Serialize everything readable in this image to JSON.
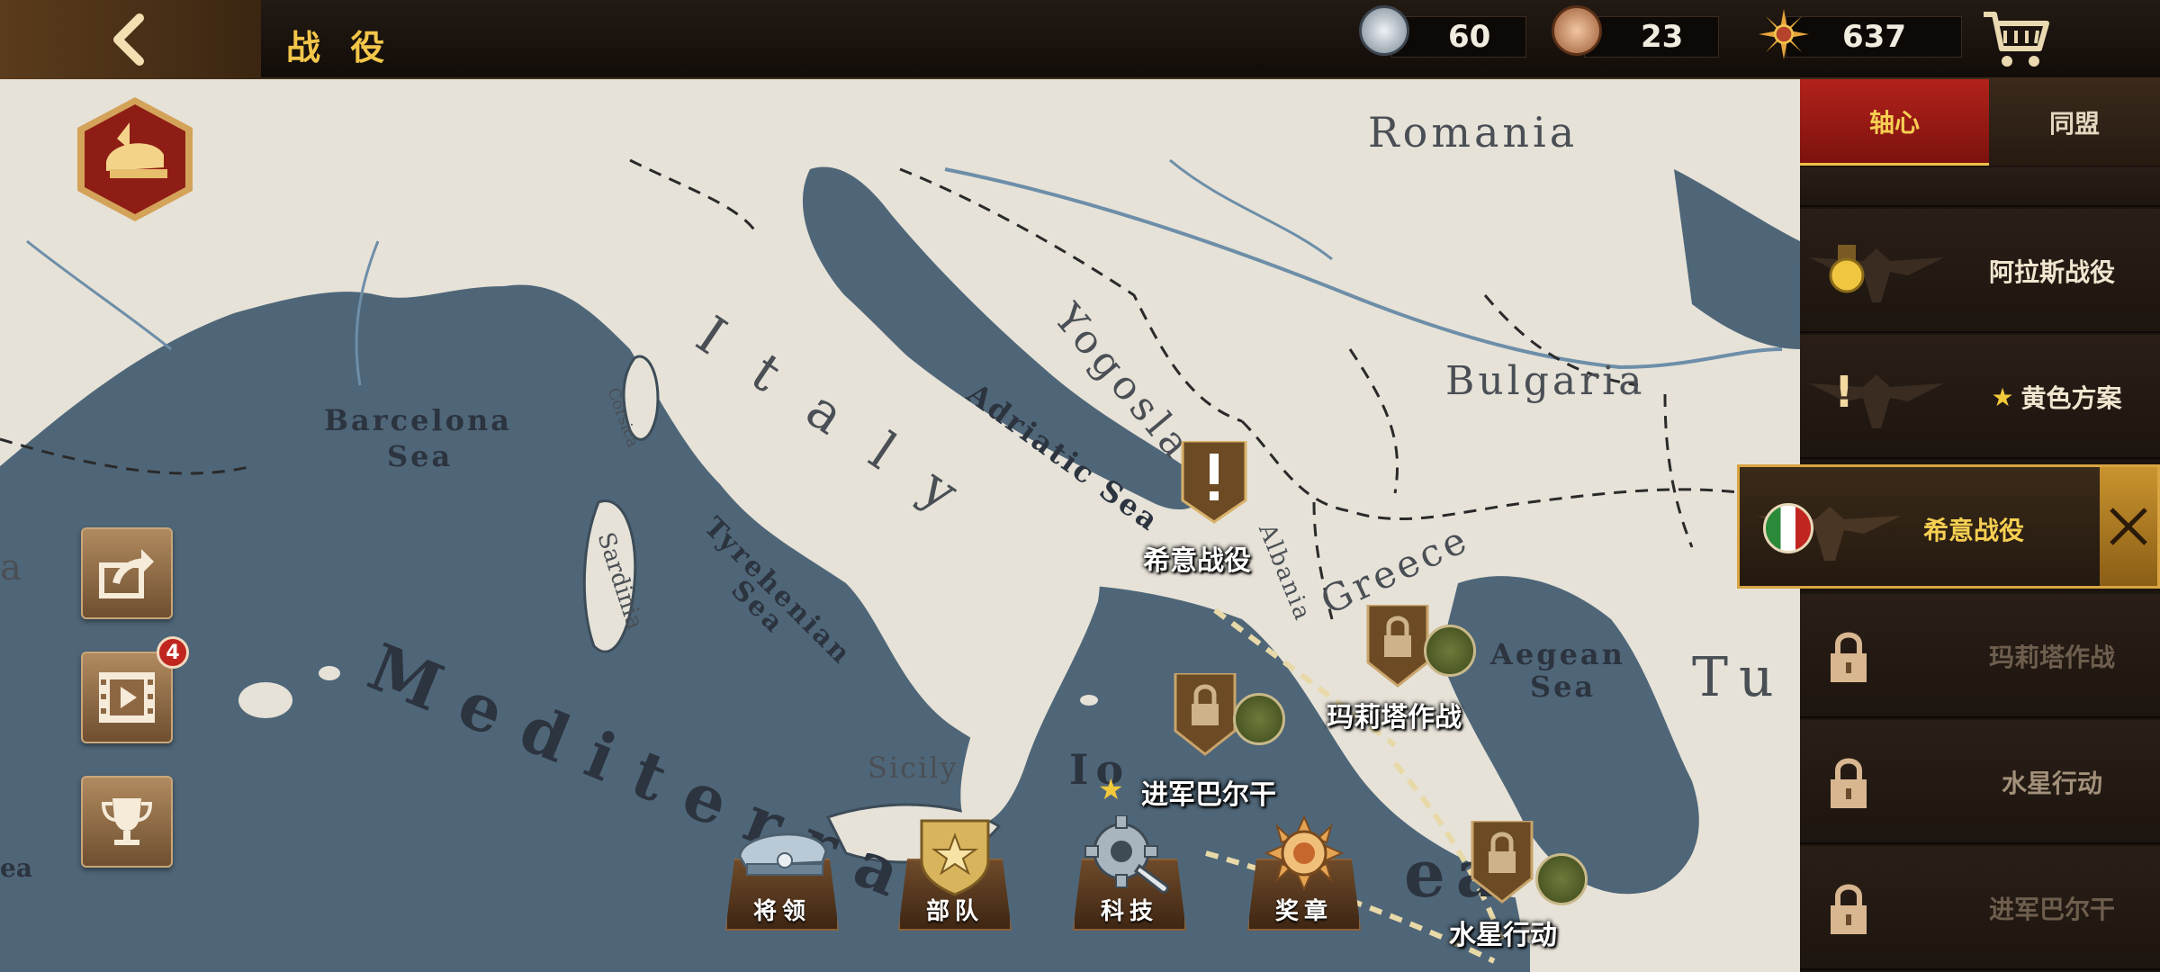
{
  "header": {
    "title": "战 役",
    "resources": [
      {
        "icon": "silver-medal-icon",
        "value": "60"
      },
      {
        "icon": "bronze-medal-icon",
        "value": "23"
      },
      {
        "icon": "gold-sun-icon",
        "value": "637"
      }
    ]
  },
  "map": {
    "countries": [
      "Romania",
      "Yogoslavia",
      "Bulgaria",
      "Greece",
      "Albania",
      "Italy",
      "Tu"
    ],
    "seas": [
      "Barcelona Sea",
      "Tyrehenian Sea",
      "Adriatic Sea",
      "Aegean Sea",
      "Mediterranean Sea",
      "Ionian Sea"
    ],
    "islands": [
      "Corsica",
      "Sardinia",
      "Sicily"
    ],
    "label_text": {
      "romania": "Romania",
      "yogoslavia": "Yogoslavia",
      "bulgaria": "Bulgaria",
      "greece": "Greece",
      "albania": "Albania",
      "italy": "I t a l y",
      "turkey": "Tu",
      "barcelona1": "Barcelona",
      "barcelona2": "Sea",
      "tyrehenian1": "Tyrehenian",
      "tyrehenian2": "Sea",
      "adriatic": "Adriatic Sea",
      "aegean1": "Aegean",
      "aegean2": "Sea",
      "mediterranean": "Mediterra",
      "mediterranean_ea": "ea",
      "ionian": "Io",
      "corsica": "Corsica",
      "sardinia": "Sardinia",
      "sicily": "Sicily",
      "a_left": "a",
      "ea_left": "ea"
    },
    "nodes": [
      {
        "name": "希意战役",
        "state": "alert",
        "emblem": ""
      },
      {
        "name": "玛莉塔作战",
        "state": "locked",
        "emblem": "lion-emblem-icon"
      },
      {
        "name": "进军巴尔干",
        "state": "locked",
        "emblem": "tank-emblem-icon",
        "starred": true
      },
      {
        "name": "水星行动",
        "state": "locked",
        "emblem": "eagle-emblem-icon"
      }
    ]
  },
  "left_buttons": {
    "share_badge": "4"
  },
  "bottom_buttons": [
    {
      "label": "将领",
      "icon": "officer-cap-icon"
    },
    {
      "label": "部队",
      "icon": "army-badge-icon"
    },
    {
      "label": "科技",
      "icon": "gear-wrench-icon"
    },
    {
      "label": "奖章",
      "icon": "medal-icon"
    }
  ],
  "right_panel": {
    "tabs": [
      {
        "label": "轴心",
        "active": true
      },
      {
        "label": "同盟",
        "active": false
      }
    ],
    "campaigns": [
      {
        "name": "阿拉斯战役",
        "state": "done"
      },
      {
        "name": "黄色方案",
        "state": "alert",
        "star": "★"
      },
      {
        "name": "希意战役",
        "state": "active"
      },
      {
        "name": "玛莉塔作战",
        "state": "locked"
      },
      {
        "name": "水星行动",
        "state": "locked"
      },
      {
        "name": "进军巴尔干",
        "state": "locked"
      }
    ]
  },
  "colors": {
    "accent_gold": "#f3c64a",
    "sea": "#4f6678",
    "land": "#e6e2d8",
    "axis_red": "#9e1c16"
  }
}
